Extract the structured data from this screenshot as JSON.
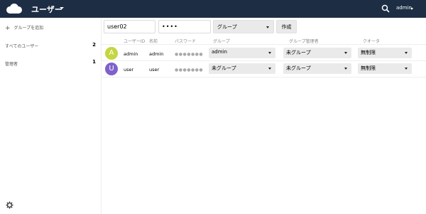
{
  "header": {
    "app_title": "ユーザー",
    "user_menu": "admin"
  },
  "sidebar": {
    "add_group": "グループを追加",
    "items": [
      {
        "label": "すべてのユーザー",
        "count": "2"
      },
      {
        "label": "管理者",
        "count": "1"
      }
    ]
  },
  "create_form": {
    "username_value": "user02",
    "password_value": "••••",
    "group_select": "グループ",
    "create_button": "作成"
  },
  "table": {
    "headers": {
      "user_id": "ユーザーID",
      "name": "名前",
      "password": "パスワード",
      "group": "グループ",
      "group_admin": "グループ管理者",
      "quota": "クオータ"
    },
    "rows": [
      {
        "avatar": "A",
        "avatar_color": "#c4d640",
        "user_id": "admin",
        "name": "admin",
        "password": "●●●●●●●",
        "group": "admin",
        "group_admin": "未グループ",
        "quota": "無制限"
      },
      {
        "avatar": "U",
        "avatar_color": "#7e62c9",
        "user_id": "user",
        "name": "user",
        "password": "●●●●●●●",
        "group": "未グループ",
        "group_admin": "未グループ",
        "quota": "無制限"
      }
    ]
  },
  "colors": {
    "header_bg": "#1d2d44",
    "avatar_admin": "#c4d640",
    "avatar_user": "#7e62c9"
  }
}
